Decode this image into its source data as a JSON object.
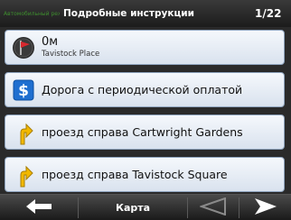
{
  "header": {
    "mode": "Автомобильный режим",
    "title": "Подробные инструкции",
    "page": "1/22"
  },
  "items": [
    {
      "distance": "0м",
      "street": "Tavistock Place",
      "icon": "destination-flag-icon"
    },
    {
      "label": "Дорога с периодической оплатой",
      "icon": "toll-road-icon"
    },
    {
      "label": "проезд справа Cartwright Gardens",
      "icon": "turn-right-arrow-icon"
    },
    {
      "label": "проезд справа Tavistock Square",
      "icon": "turn-right-arrow-icon"
    }
  ],
  "toolbar": {
    "back_icon": "back-arrow-icon",
    "map_label": "Карта",
    "prev_icon": "triangle-left-icon",
    "next_icon": "arrow-right-icon"
  },
  "colors": {
    "item_bg_top": "#f5f8fc",
    "item_bg_bottom": "#d9e2ee",
    "item_border": "#8ea3bd",
    "toll_blue": "#1f6fd0",
    "arrow_yellow": "#f2b800",
    "mode_green": "#3e8e2e"
  }
}
